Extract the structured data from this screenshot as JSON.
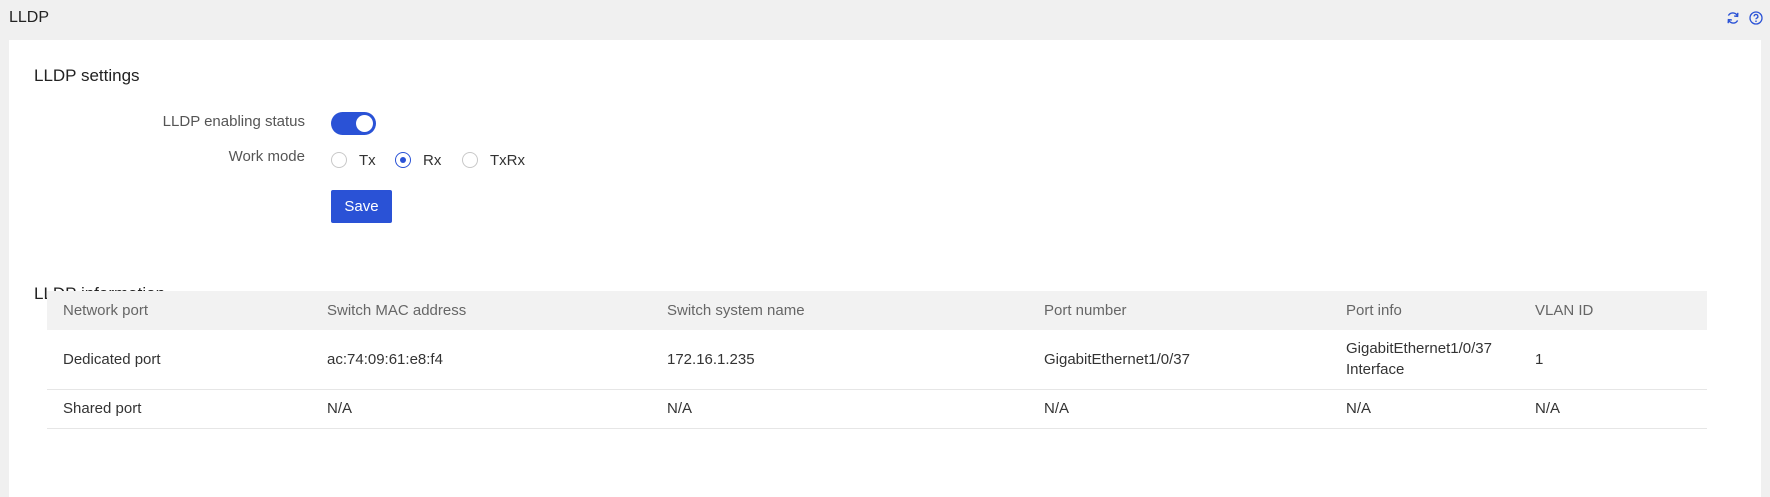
{
  "header": {
    "title": "LLDP",
    "icons": [
      "refresh-icon",
      "help-icon"
    ]
  },
  "settings": {
    "title": "LLDP settings",
    "enabling_label": "LLDP enabling status",
    "enabling_on": true,
    "work_mode_label": "Work mode",
    "work_mode_options": [
      "Tx",
      "Rx",
      "TxRx"
    ],
    "work_mode_selected": "Rx",
    "save_label": "Save"
  },
  "info": {
    "title": "LLDP information",
    "columns": [
      "Network port",
      "Switch MAC address",
      "Switch system name",
      "Port number",
      "Port info",
      "VLAN ID"
    ],
    "rows": [
      [
        "Dedicated port",
        "ac:74:09:61:e8:f4",
        "172.16.1.235",
        "GigabitEthernet1/0/37",
        "GigabitEthernet1/0/37 Interface",
        "1"
      ],
      [
        "Shared port",
        "N/A",
        "N/A",
        "N/A",
        "N/A",
        "N/A"
      ]
    ]
  },
  "colors": {
    "accent": "#2a52d6",
    "header_bg": "#f0f0f0",
    "table_header_bg": "#f2f2f2"
  }
}
